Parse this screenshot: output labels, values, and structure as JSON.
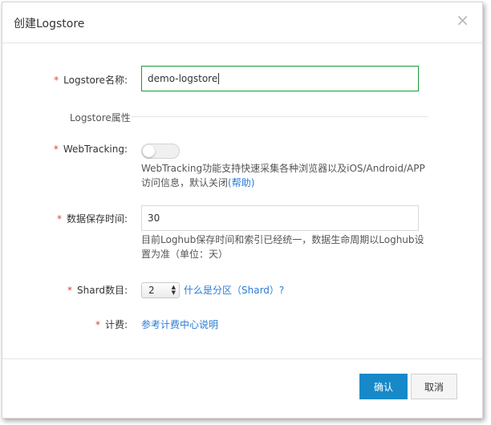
{
  "dialog": {
    "title": "创建Logstore",
    "close_glyph": "×"
  },
  "form": {
    "required_mark": "*",
    "name": {
      "label": "Logstore名称:",
      "value": "demo-logstore"
    },
    "section_title": "Logstore属性",
    "webtracking": {
      "label": "WebTracking:",
      "enabled": false,
      "help_line1": "WebTracking功能支持快速采集各种浏览器以及iOS/Android/APP",
      "help_line2": "访问信息，默认关闭",
      "help_link": "(帮助)"
    },
    "retention": {
      "label": "数据保存时间:",
      "value": "30",
      "help_line1": "目前Loghub保存时间和索引已经统一，数据生命周期以Loghub设",
      "help_line2": "置为准（单位：天）"
    },
    "shard": {
      "label": "Shard数目:",
      "value": "2",
      "link": "什么是分区（Shard）?"
    },
    "billing": {
      "label": "计费:",
      "link": "参考计费中心说明"
    }
  },
  "footer": {
    "confirm_label": "确认",
    "cancel_label": "取消"
  },
  "colors": {
    "required": "#e0423a",
    "link": "#2a7bd5",
    "primary_button": "#1789c8",
    "focus_border": "#1a9b3c"
  },
  "icons": {
    "close": "close-icon",
    "stepper": "chevron-up-down-icon"
  }
}
